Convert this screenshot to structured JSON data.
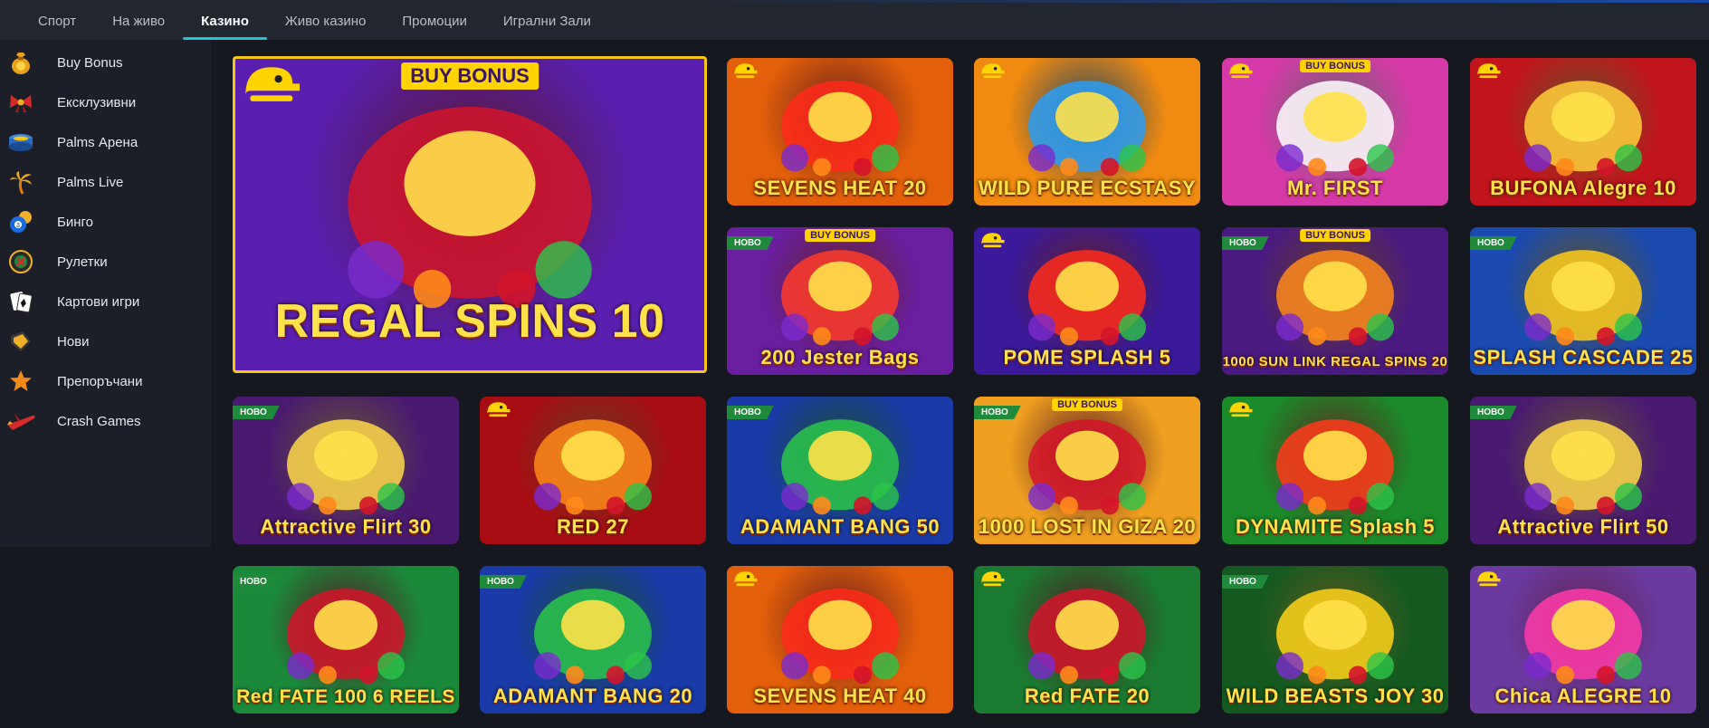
{
  "nav": [
    {
      "label": "Спорт",
      "active": false
    },
    {
      "label": "На живо",
      "active": false
    },
    {
      "label": "Казино",
      "active": true
    },
    {
      "label": "Живо казино",
      "active": false
    },
    {
      "label": "Промоции",
      "active": false
    },
    {
      "label": "Игрални Зали",
      "active": false
    }
  ],
  "sidebar": {
    "items": [
      {
        "label": "Buy Bonus",
        "icon": "money-bag-icon"
      },
      {
        "label": "Ексклузивни",
        "icon": "gift-bow-icon"
      },
      {
        "label": "Palms Арена",
        "icon": "arena-icon"
      },
      {
        "label": "Palms Live",
        "icon": "palm-tree-icon"
      },
      {
        "label": "Бинго",
        "icon": "bingo-ball-icon"
      },
      {
        "label": "Рулетки",
        "icon": "roulette-icon"
      },
      {
        "label": "Картови игри",
        "icon": "playing-cards-icon"
      },
      {
        "label": "Нови",
        "icon": "new-tag-icon"
      },
      {
        "label": "Препоръчани",
        "icon": "star-icon"
      },
      {
        "label": "Crash Games",
        "icon": "airplane-icon"
      }
    ]
  },
  "badges": {
    "new": "НОВО",
    "buy_bonus": "BUY BONUS"
  },
  "games": [
    {
      "title": "REGAL SPINS 10",
      "buy_bonus": true,
      "new": false,
      "bg": "#5a1fb0",
      "accent": "#d4142a"
    },
    {
      "title": "SEVENS HEAT 20",
      "buy_bonus": false,
      "new": false,
      "bg": "#e35f0a",
      "accent": "#ff2a1a"
    },
    {
      "title": "WILD PURE ECSTASY",
      "buy_bonus": false,
      "new": false,
      "bg": "#f08a10",
      "accent": "#2a9df5"
    },
    {
      "title": "Mr. FIRST",
      "buy_bonus": true,
      "new": false,
      "bg": "#d63aa8",
      "accent": "#ffffff"
    },
    {
      "title": "BUFONA Alegre 10",
      "buy_bonus": false,
      "new": false,
      "bg": "#c2141c",
      "accent": "#ffcf3a"
    },
    {
      "title": "200 Jester Bags",
      "buy_bonus": true,
      "new": true,
      "bg": "#6a1ea0",
      "accent": "#ff3a2a"
    },
    {
      "title": "POME SPLASH 5",
      "buy_bonus": false,
      "new": false,
      "bg": "#3a1a9a",
      "accent": "#ff2a1a"
    },
    {
      "title": "1000 SUN LINK REGAL SPINS 20",
      "buy_bonus": true,
      "new": true,
      "bg": "#4a1a80",
      "accent": "#ff8a1a"
    },
    {
      "title": "SPLASH CASCADE 25",
      "buy_bonus": false,
      "new": true,
      "bg": "#1a4ab0",
      "accent": "#ffcc1a"
    },
    {
      "title": "Attractive Flirt 30",
      "buy_bonus": false,
      "new": true,
      "bg": "#4a1a70",
      "accent": "#ffd84a"
    },
    {
      "title": "RED 27",
      "buy_bonus": false,
      "new": false,
      "bg": "#a80d14",
      "accent": "#ff8a1a"
    },
    {
      "title": "ADAMANT BANG 50",
      "buy_bonus": false,
      "new": true,
      "bg": "#1a3aa8",
      "accent": "#2ac64a"
    },
    {
      "title": "1000 LOST IN GIZA 20",
      "buy_bonus": true,
      "new": true,
      "bg": "#f0a020",
      "accent": "#d4142a"
    },
    {
      "title": "DYNAMITE Splash 5",
      "buy_bonus": false,
      "new": false,
      "bg": "#1a8a2a",
      "accent": "#ff3a1a"
    },
    {
      "title": "Attractive Flirt 50",
      "buy_bonus": false,
      "new": true,
      "bg": "#4a1a70",
      "accent": "#ffd84a"
    },
    {
      "title": "Red FATE 100 6 REELS",
      "buy_bonus": false,
      "new": true,
      "bg": "#1a8a3a",
      "accent": "#d4142a"
    },
    {
      "title": "ADAMANT BANG 20",
      "buy_bonus": false,
      "new": true,
      "bg": "#1a3aa8",
      "accent": "#2ac64a"
    },
    {
      "title": "SEVENS HEAT 40",
      "buy_bonus": false,
      "new": false,
      "bg": "#e35f0a",
      "accent": "#ff2a1a"
    },
    {
      "title": "Red FATE 20",
      "buy_bonus": false,
      "new": false,
      "bg": "#1a7a30",
      "accent": "#d4142a"
    },
    {
      "title": "WILD BEASTS JOY 30",
      "buy_bonus": false,
      "new": true,
      "bg": "#145a20",
      "accent": "#ffd41a"
    },
    {
      "title": "Chica ALEGRE 10",
      "buy_bonus": false,
      "new": false,
      "bg": "#6a3aa0",
      "accent": "#ff3aa8"
    }
  ],
  "colors": {
    "accent_tab": "#1fc7d4",
    "big_border": "#f5c518",
    "provider_logo": "#ffd400"
  }
}
